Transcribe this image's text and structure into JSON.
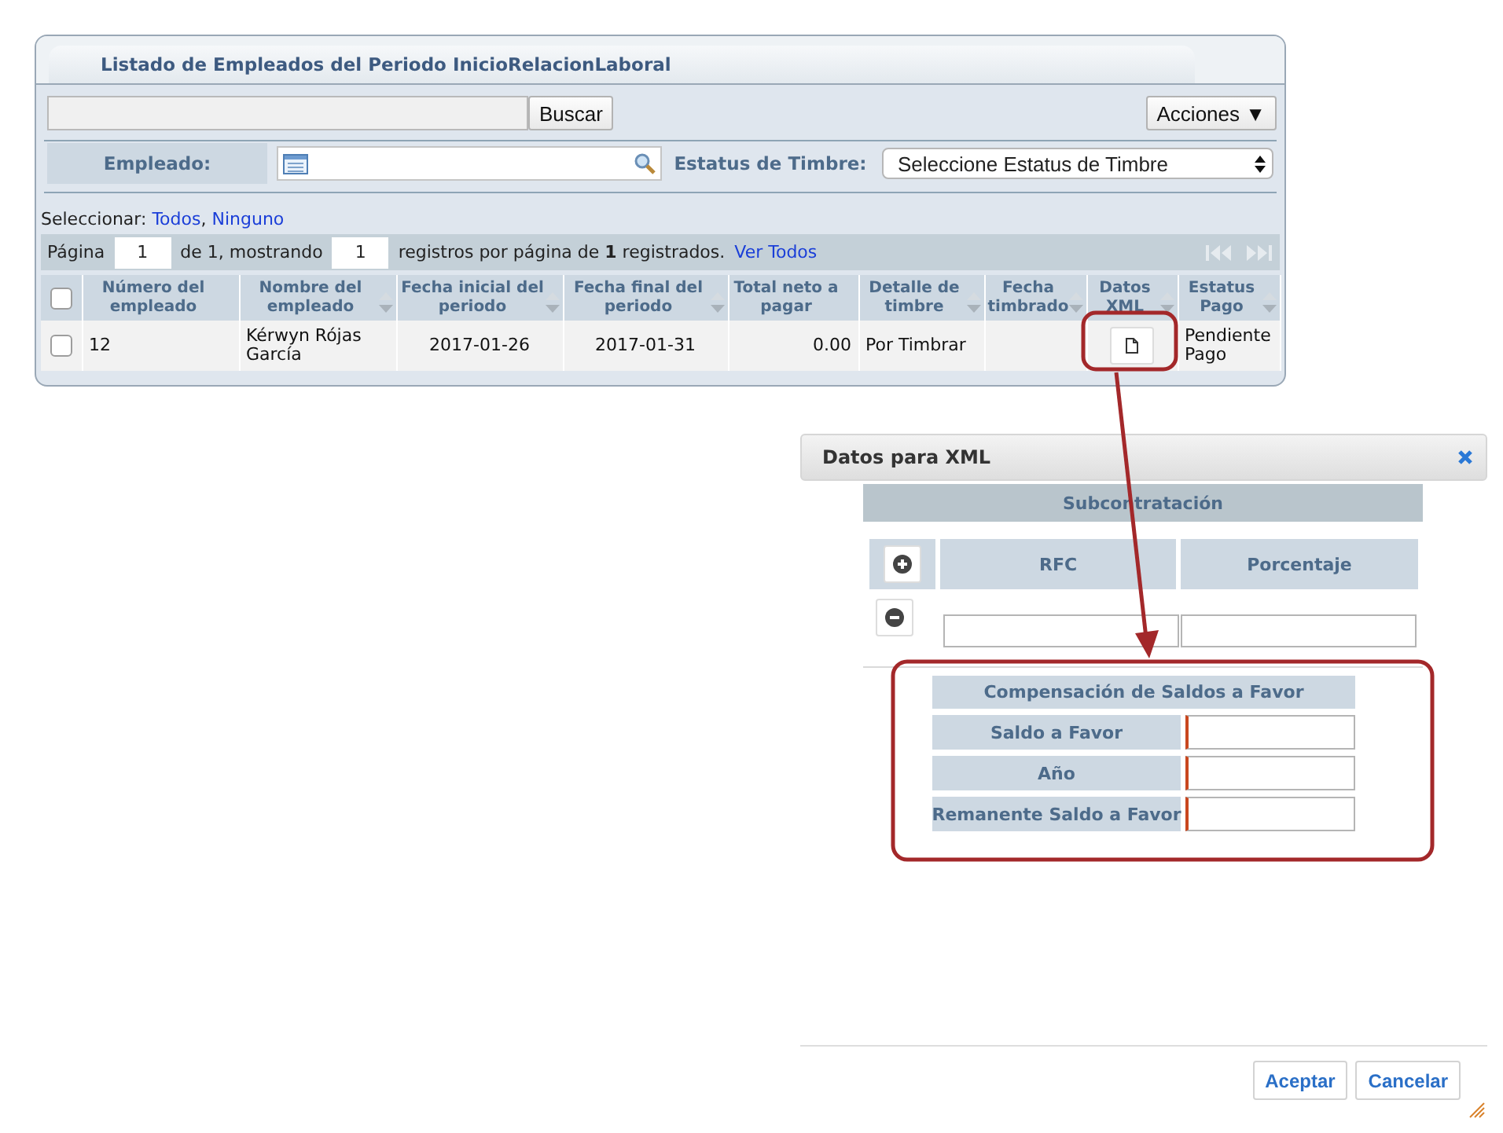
{
  "panel": {
    "title": "Listado de Empleados del Periodo InicioRelacionLaboral",
    "search_button": "Buscar",
    "actions_button": "Acciones ▼",
    "filters": [
      {
        "kind": "search",
        "label": "Empleado:"
      },
      {
        "kind": "select",
        "label": "Estatus de Timbre:",
        "value": "Seleccione Estatus de Timbre"
      }
    ],
    "selection": {
      "label": "Seleccionar:",
      "links": [
        "Todos",
        "Ninguno"
      ],
      "separator": ","
    },
    "pager": {
      "page_label": "Página",
      "page": "1",
      "of_text": "de 1, mostrando",
      "per_page": "1",
      "summary": "registros por página de **1** registrados.",
      "view_all": "Ver Todos"
    },
    "table": {
      "header_checked": false,
      "columns": [
        {
          "label": "Número del empleado",
          "sortable": false
        },
        {
          "label": "Nombre del empleado",
          "sortable": true
        },
        {
          "label": "Fecha inicial del periodo",
          "sortable": true
        },
        {
          "label": "Fecha final del periodo",
          "sortable": true
        },
        {
          "label": "Total neto a pagar",
          "sortable": false
        },
        {
          "label": "Detalle de timbre",
          "sortable": true
        },
        {
          "label": "Fecha timbrado",
          "sortable": true
        },
        {
          "label": "Datos XML",
          "sortable": true
        },
        {
          "label": "Estatus Pago",
          "sortable": true
        }
      ],
      "rows": [
        {
          "checked": false,
          "cells": [
            {
              "kind": "text",
              "text": "12"
            },
            {
              "kind": "text",
              "text": "Kérwyn Rójas García"
            },
            {
              "kind": "text",
              "text": "2017-01-26"
            },
            {
              "kind": "text",
              "text": "2017-01-31"
            },
            {
              "kind": "text",
              "text": "0.00"
            },
            {
              "kind": "text",
              "text": "Por Timbrar"
            },
            {
              "kind": "empty"
            },
            {
              "kind": "button"
            },
            {
              "kind": "text",
              "text": "Pendiente Pago"
            }
          ]
        }
      ]
    }
  },
  "dialog": {
    "title": "Datos para XML",
    "subcontracting": {
      "title": "Subcontratación",
      "columns": [
        "RFC",
        "Porcentaje"
      ]
    },
    "compensation": {
      "title": "Compensación de Saldos a Favor",
      "fields": [
        {
          "label": "Saldo a Favor",
          "required": true
        },
        {
          "label": "Año",
          "required": true
        },
        {
          "label": "Remanente Saldo a Favor",
          "required": true
        }
      ]
    },
    "buttons": [
      "Aceptar",
      "Cancelar"
    ]
  }
}
